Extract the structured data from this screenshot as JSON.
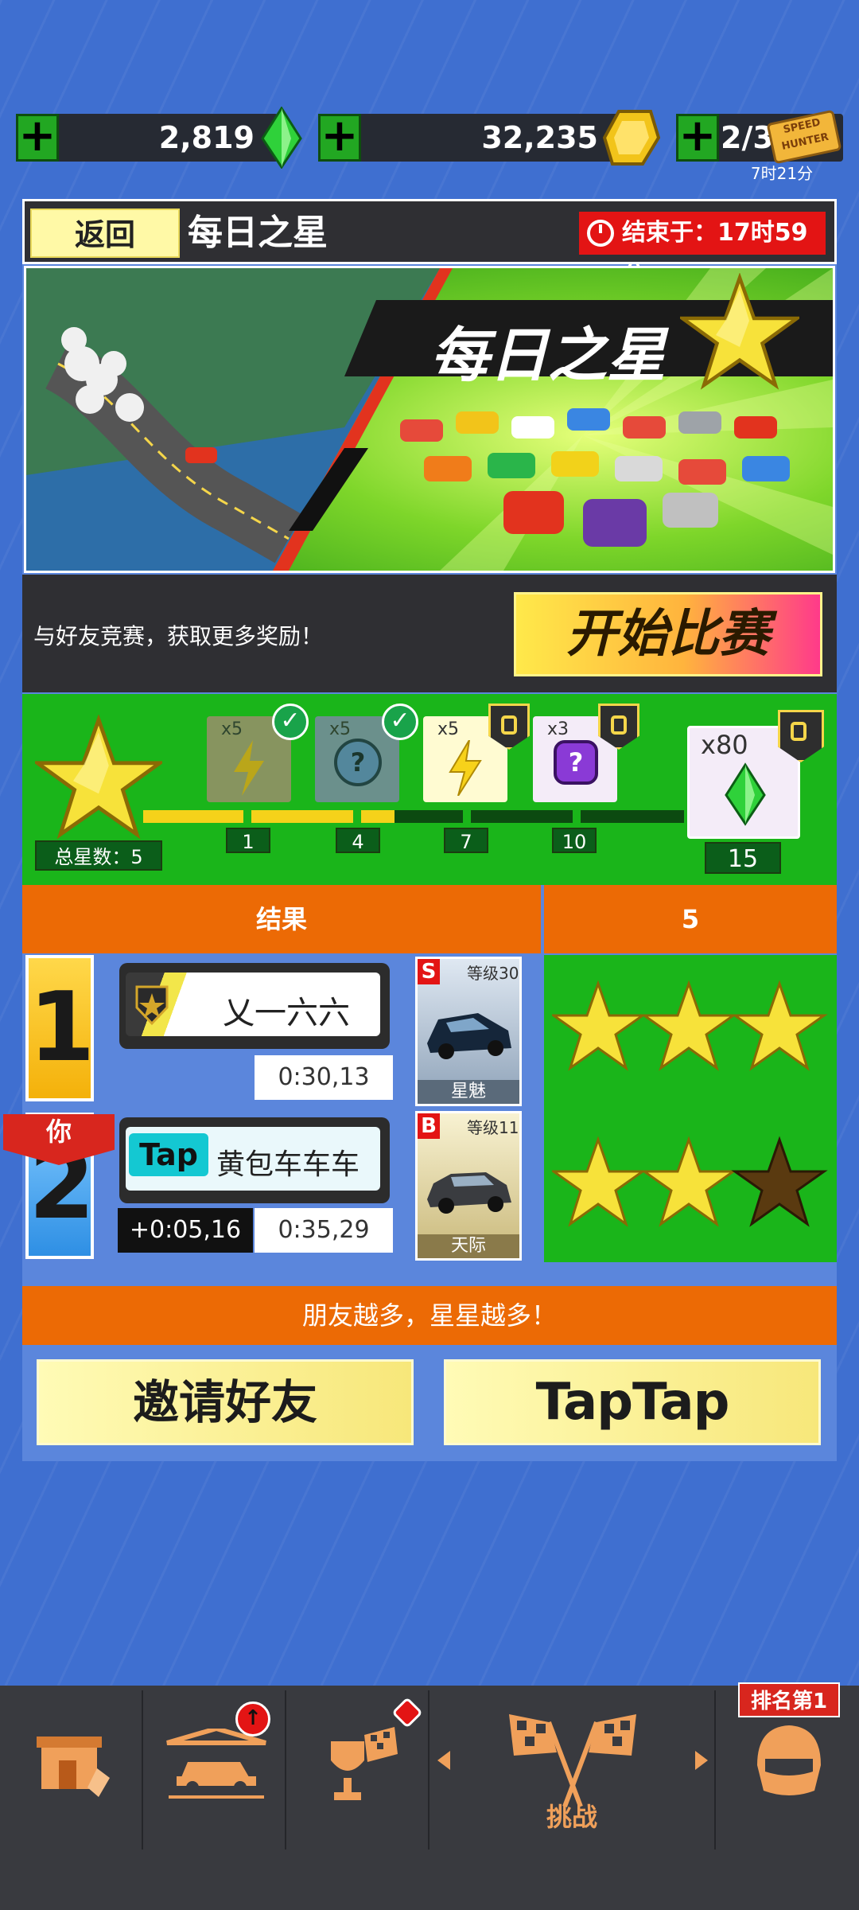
{
  "currency": {
    "gems": "2,819",
    "coins": "32,235",
    "tickets": "2/3",
    "ticket_timer": "7时21分",
    "ticket_label_1": "SPEED",
    "ticket_label_2": "HUNTER",
    "plus": "+"
  },
  "header": {
    "back_label": "返回",
    "title": "每日之星",
    "timer_text": "结束于：17时59分"
  },
  "banner": {
    "title": "每日之星"
  },
  "promo": {
    "description": "与好友竞赛，获取更多奖励！",
    "start_button": "开始比赛"
  },
  "progress": {
    "total_stars_label": "总星数：5",
    "total_stars": 5,
    "max_stars": 15,
    "milestones": [
      "1",
      "4",
      "7",
      "10",
      "15"
    ],
    "rewards": [
      {
        "qty": "x5",
        "item": "lightning-card",
        "state": "claimed"
      },
      {
        "qty": "x5",
        "item": "mystery-token-blue",
        "state": "claimed"
      },
      {
        "qty": "x5",
        "item": "lightning-card",
        "state": "locked"
      },
      {
        "qty": "x3",
        "item": "mystery-token-purple",
        "state": "locked"
      },
      {
        "qty": "x80",
        "item": "green-gem",
        "state": "locked"
      }
    ]
  },
  "results": {
    "header_label": "结果",
    "header_value": "5",
    "you_label": "你",
    "rows": [
      {
        "rank": "1",
        "player": "乂一六六",
        "time": "0:30,13",
        "delta": "",
        "car_class": "S",
        "car_level": "等级30",
        "car_name": "星魅",
        "stars_earned": 3
      },
      {
        "rank": "2",
        "player": "黄包车车车",
        "badge": "Tap",
        "time": "0:35,29",
        "delta": "+0:05,16",
        "car_class": "B",
        "car_level": "等级11",
        "car_name": "天际",
        "stars_earned": 2
      }
    ]
  },
  "friends": {
    "banner_text": "朋友越多，星星越多！",
    "invite_button": "邀请好友",
    "taptap_button": "TapTap"
  },
  "navbar": {
    "active_label": "挑战",
    "rank_badge": "排名第1",
    "items": [
      "store-icon",
      "garage-icon",
      "trophy-flag-icon",
      "checkered-flags-icon",
      "helmet-icon"
    ]
  },
  "colors": {
    "orange": "#ec6a05",
    "green": "#1ab51a",
    "blue_bg": "#3f6fd0",
    "panel_dark": "#2f2f33",
    "red": "#e31414",
    "yellow": "#f5d64a"
  }
}
